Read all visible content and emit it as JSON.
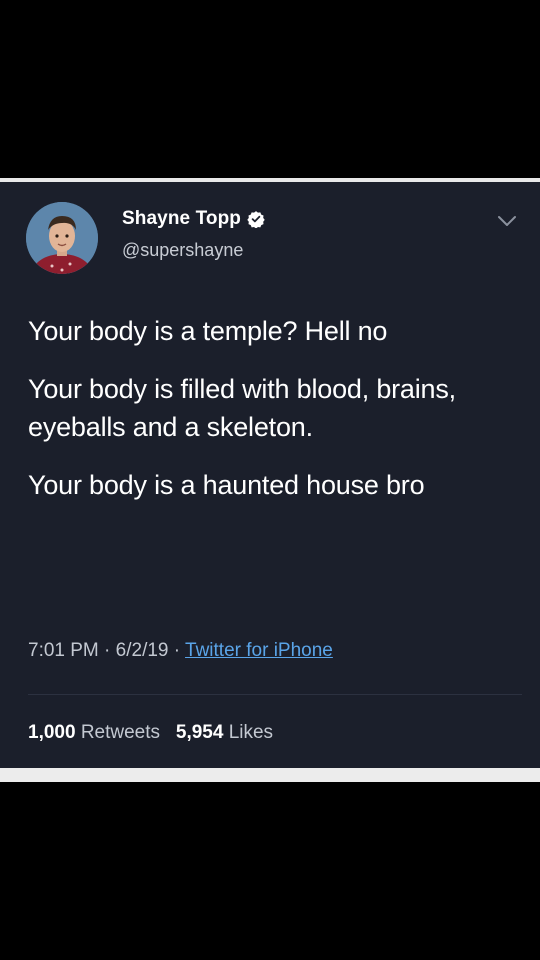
{
  "tweet": {
    "display_name": "Shayne Topp",
    "handle": "@supershayne",
    "verified_icon": "verified-badge-icon",
    "menu_icon": "chevron-down-icon",
    "paragraphs": [
      "Your body is a temple? Hell no",
      "Your body is filled with blood, brains, eyeballs and a skeleton.",
      "Your body is a haunted house bro"
    ],
    "time": "7:01 PM",
    "date": "6/2/19",
    "separator": "·",
    "source": "Twitter for iPhone",
    "retweets_count": "1,000",
    "retweets_label": "Retweets",
    "likes_count": "5,954",
    "likes_label": "Likes"
  },
  "colors": {
    "card_background": "#1b1f2b",
    "link": "#5aa4e8",
    "verified": "#ffffff"
  }
}
